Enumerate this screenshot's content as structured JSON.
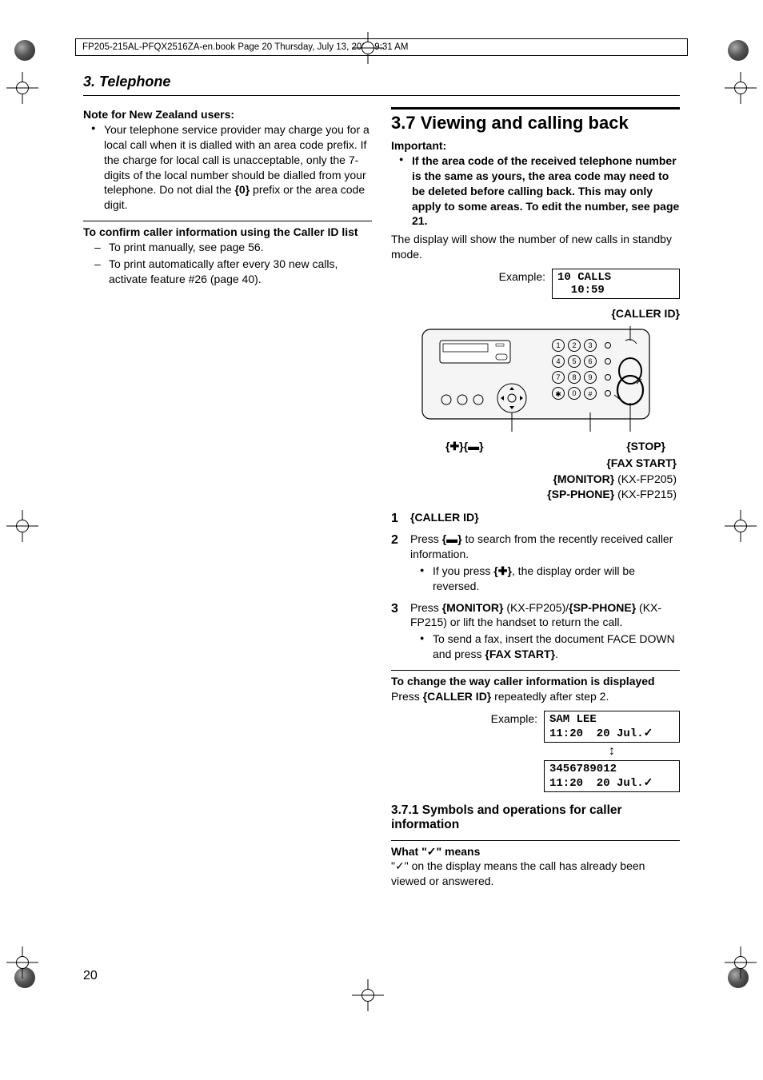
{
  "header": {
    "file_info": "FP205-215AL-PFQX2516ZA-en.book  Page 20  Thursday, July 13, 2006  9:31 AM"
  },
  "chapter": "3. Telephone",
  "left": {
    "nz_heading": "Note for New Zealand users:",
    "nz_bullet": "Your telephone service provider may charge you for a local call when it is dialled with an area code prefix. If the charge for local call is unacceptable, only the 7-digits of the local number should be dialled from your telephone. Do not dial the {0} prefix or the area code digit.",
    "confirm_heading": "To confirm caller information using the Caller ID list",
    "dash1": "To print manually, see page 56.",
    "dash2": "To print automatically after every 30 new calls, activate feature #26 (page 40)."
  },
  "right": {
    "section_num_title": "3.7 Viewing and calling back",
    "important_label": "Important:",
    "important_bullet": "If the area code of the received telephone number is the same as yours, the area code may need to be deleted before calling back. This may only apply to some areas. To edit the number, see page 21.",
    "intro": "The display will show the number of new calls in standby mode.",
    "example_label": "Example:",
    "display_line1": "10 CALLS",
    "display_line2": "  10:59",
    "btn_callerid": "{CALLER ID}",
    "btn_plusminus": "{A}{B}",
    "btn_stop": "{STOP}",
    "btn_faxstart": "{FAX START}",
    "btn_monitor_line": "{MONITOR} (KX-FP205)",
    "btn_spphone_line": "{SP-PHONE} (KX-FP215)",
    "step1": "{CALLER ID}",
    "step2_a": "Press ",
    "step2_b": "{B}",
    "step2_c": " to search from the recently received caller information.",
    "step2_sub_a": "If you press ",
    "step2_sub_b": "{A}",
    "step2_sub_c": ", the display order will be reversed.",
    "step3_a": "Press ",
    "step3_b": "{MONITOR}",
    "step3_c": " (KX-FP205)/",
    "step3_d": "{SP-PHONE}",
    "step3_e": " (KX-FP215) or lift the handset to return the call.",
    "step3_sub_a": "To send a fax, insert the document FACE DOWN and press ",
    "step3_sub_b": "{FAX START}",
    "step3_sub_c": ".",
    "change_heading": "To change the way caller information is displayed",
    "change_a": "Press ",
    "change_b": "{CALLER ID}",
    "change_c": " repeatedly after step 2.",
    "ex2_line1": "SAM LEE",
    "ex2_line2": "11:20  20 Jul.",
    "ex3_line1": "3456789012",
    "ex3_line2": "11:20  20 Jul.",
    "subsection": "3.7.1 Symbols and operations for caller information",
    "what_means_a": "What \"",
    "what_means_b": "\" means",
    "what_body_a": "\"",
    "what_body_b": "\" on the display means the call has already been viewed or answered."
  },
  "page_number": "20",
  "chart_data": null
}
